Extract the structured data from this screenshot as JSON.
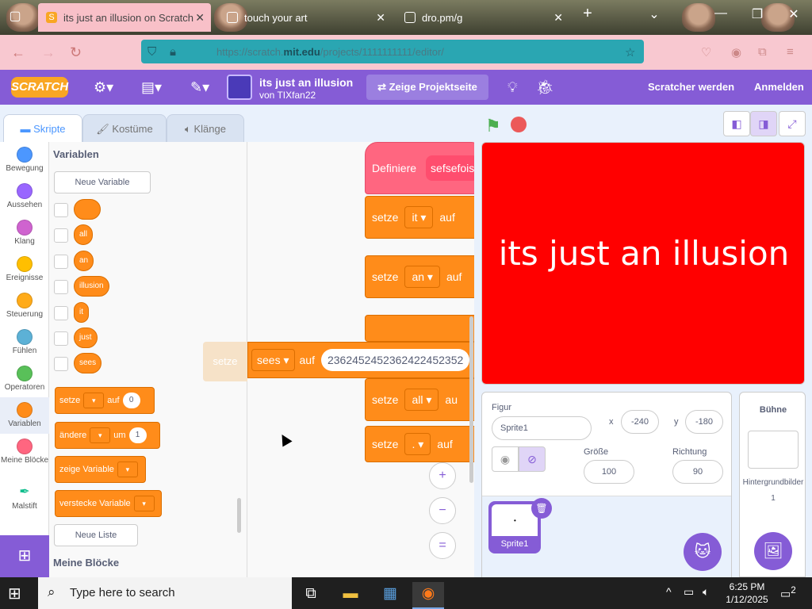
{
  "browser": {
    "tabs": [
      {
        "title": "its just an illusion on Scratch",
        "active": true,
        "icon": "scratch-favicon"
      },
      {
        "title": "touch your art",
        "active": false,
        "icon": "page-icon"
      },
      {
        "title": "dro.pm/g",
        "active": false,
        "icon": "page-icon"
      }
    ],
    "new_tab_label": "+",
    "url": {
      "prefix": "https://scratch.",
      "host": "mit.edu",
      "suffix": "/projects/1111111111/editor/"
    }
  },
  "menu": {
    "logo": "SCRATCH",
    "project_title": "its just an illusion",
    "project_author": "von TIXfan22",
    "see_project_label": "Zeige Projektseite",
    "join_label": "Scratcher werden",
    "signin_label": "Anmelden"
  },
  "editor_tabs": [
    {
      "label": "Skripte",
      "icon": "code-icon"
    },
    {
      "label": "Kostüme",
      "icon": "brush-icon"
    },
    {
      "label": "Klänge",
      "icon": "speaker-icon"
    }
  ],
  "categories": [
    {
      "label": "Bewegung",
      "color": "#4c97ff"
    },
    {
      "label": "Aussehen",
      "color": "#9966ff"
    },
    {
      "label": "Klang",
      "color": "#cf63cf"
    },
    {
      "label": "Ereignisse",
      "color": "#ffbf00"
    },
    {
      "label": "Steuerung",
      "color": "#ffab19"
    },
    {
      "label": "Fühlen",
      "color": "#5cb1d6"
    },
    {
      "label": "Operatoren",
      "color": "#59c059"
    },
    {
      "label": "Variablen",
      "color": "#ff8c1a"
    },
    {
      "label": "Meine Blöcke",
      "color": "#ff6680"
    },
    {
      "label": "Malstift",
      "color": "#0fbd8c"
    }
  ],
  "palette": {
    "heading": "Variablen",
    "new_variable_label": "Neue Variable",
    "variables": [
      "",
      "all",
      "an",
      "illusion",
      "it",
      "just",
      "sees"
    ],
    "set_block": {
      "label": "setze",
      "to": "auf",
      "value": "0"
    },
    "change_block": {
      "label": "ändere",
      "by": "um",
      "value": "1"
    },
    "show_block": "zeige Variable",
    "hide_block": "verstecke Variable",
    "new_list_label": "Neue Liste",
    "my_blocks_heading": "Meine Blöcke"
  },
  "code": {
    "define_label": "Definiere",
    "define_arg": "sefsefois",
    "blocks": [
      {
        "label": "setze",
        "var": "it",
        "to": "auf"
      },
      {
        "label": "setze",
        "var": "an",
        "to": "auf"
      },
      {
        "label": "setze",
        "var": "all",
        "to": "au"
      },
      {
        "label": "setze",
        "var": ".",
        "to": "auf"
      }
    ],
    "dragged": {
      "ghost": "setze",
      "var": "sees",
      "to": "auf",
      "value": "2362452452362422452352"
    },
    "zoom_in": "+",
    "zoom_out": "−",
    "zoom_reset": "="
  },
  "stage": {
    "text": "its just an illusion",
    "bg_color": "#ff0000"
  },
  "sprite": {
    "label": "Figur",
    "name": "Sprite1",
    "x_label": "x",
    "x": "-240",
    "y_label": "y",
    "y": "-180",
    "size_label": "Größe",
    "size": "100",
    "dir_label": "Richtung",
    "dir": "90",
    "thumb_name": "Sprite1"
  },
  "stage_panel": {
    "label": "Bühne",
    "backdrops_label": "Hintergrundbilder",
    "backdrops_count": "1"
  },
  "taskbar": {
    "search_placeholder": "Type here to search",
    "time": "6:25 PM",
    "date": "1/12/2025",
    "notifications": "2"
  }
}
